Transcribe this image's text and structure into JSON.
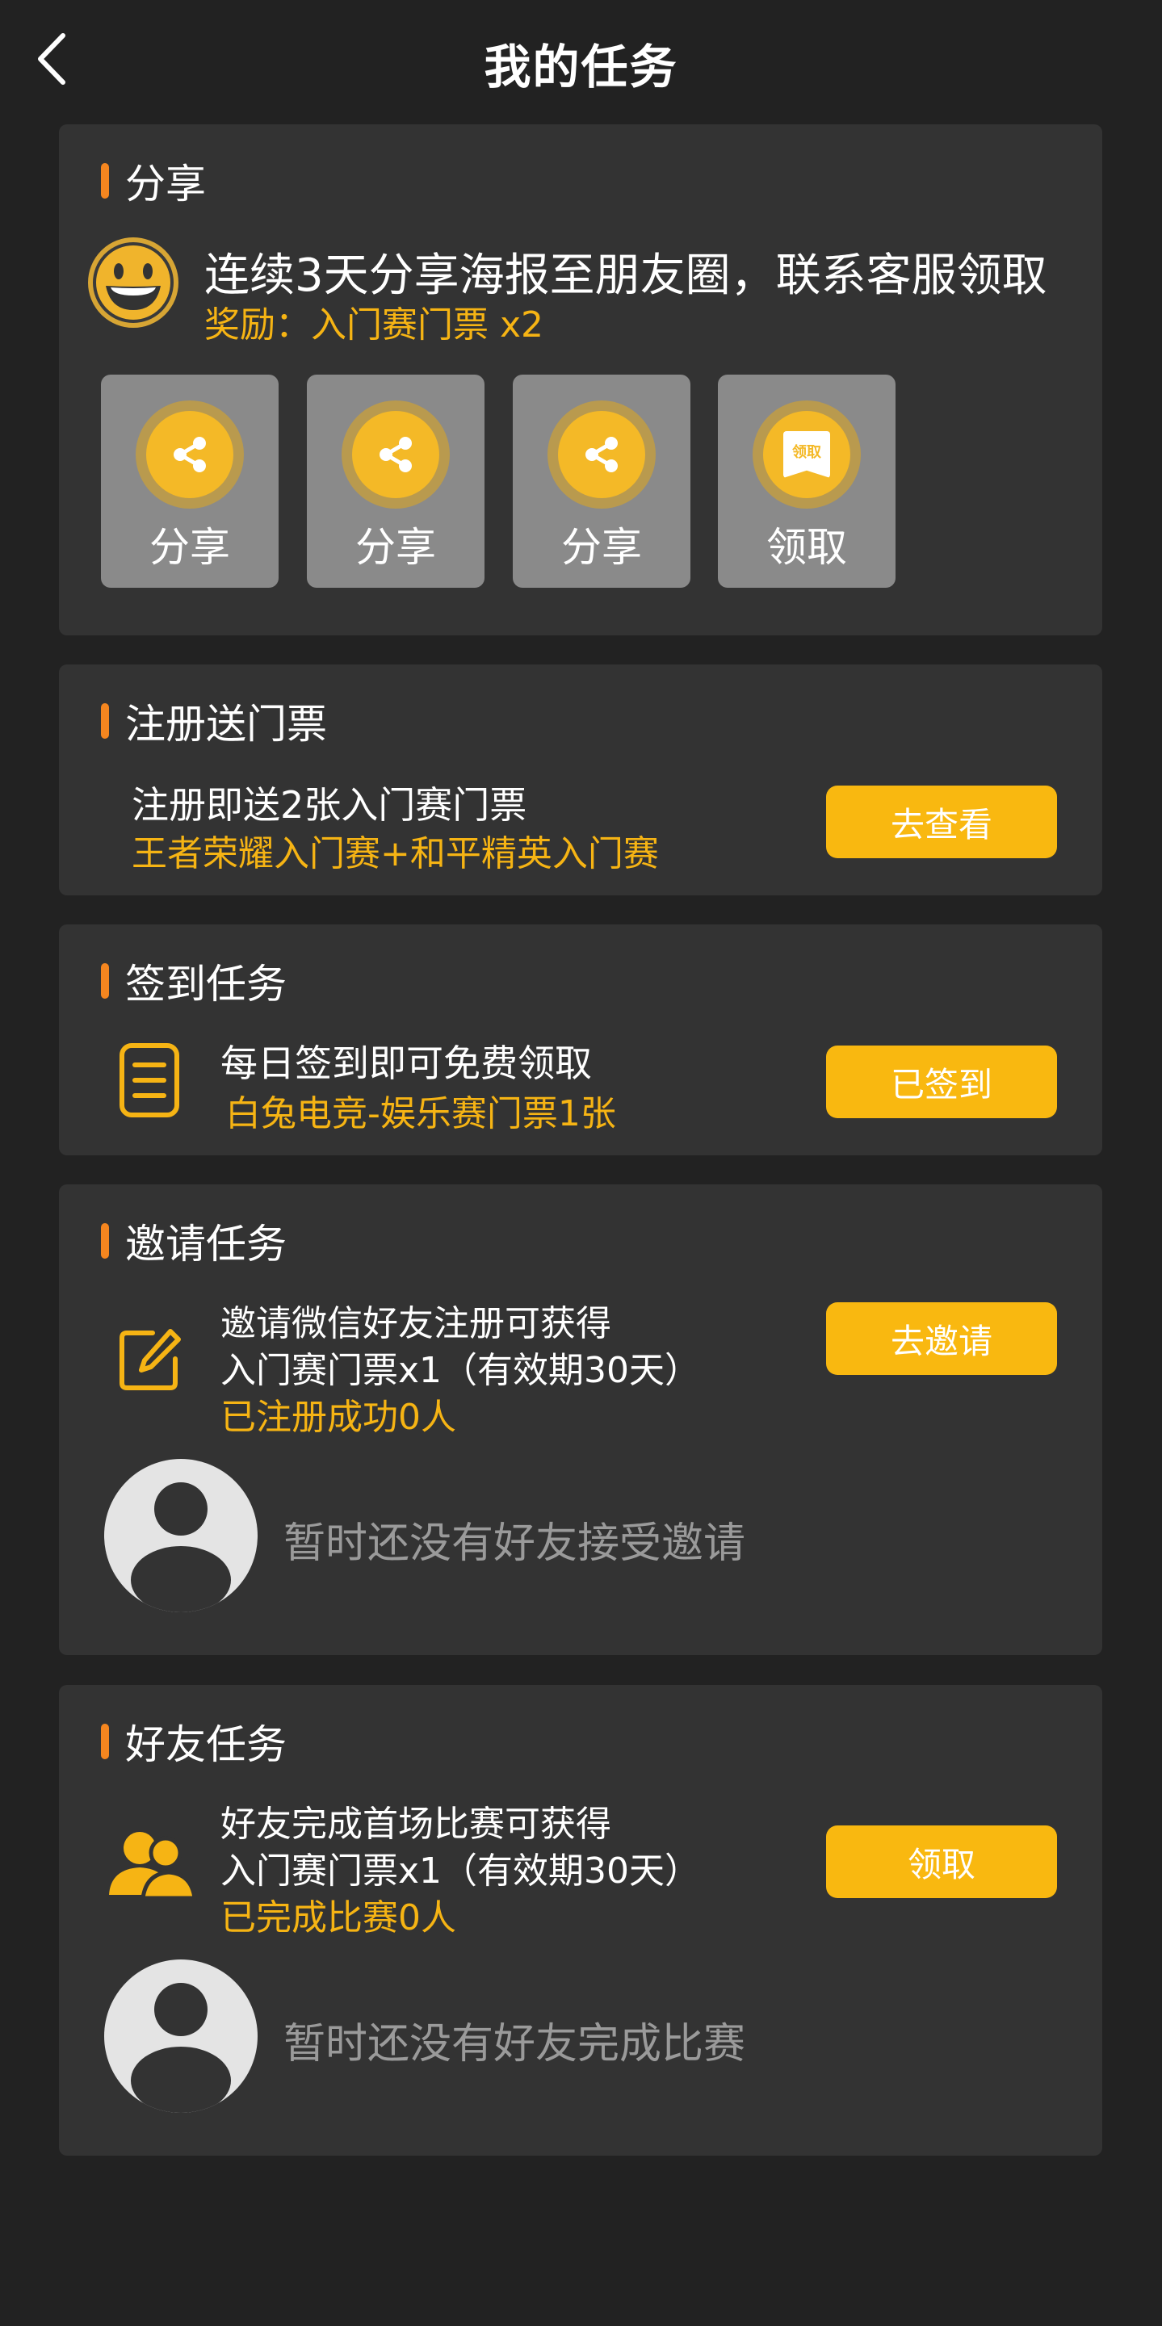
{
  "header": {
    "title": "我的任务"
  },
  "share_section": {
    "title": "分享",
    "desc": "连续3天分享海报至朋友圈，联系客服领取",
    "reward": "奖励：入门赛门票 x2",
    "tiles": [
      {
        "label": "分享",
        "icon": "share-icon"
      },
      {
        "label": "分享",
        "icon": "share-icon"
      },
      {
        "label": "分享",
        "icon": "share-icon"
      },
      {
        "label": "领取",
        "icon": "receive-badge-icon",
        "badge_text": "领取"
      }
    ]
  },
  "register_section": {
    "title": "注册送门票",
    "desc": "注册即送2张入门赛门票",
    "sub": "王者荣耀入门赛+和平精英入门赛",
    "button": "去查看"
  },
  "checkin_section": {
    "title": "签到任务",
    "desc": "每日签到即可免费领取",
    "sub": "白兔电竞-娱乐赛门票1张",
    "button": "已签到",
    "icon": "checklist-icon"
  },
  "invite_section": {
    "title": "邀请任务",
    "line1": "邀请微信好友注册可获得",
    "line2": "入门赛门票x1（有效期30天）",
    "status": "已注册成功0人",
    "button": "去邀请",
    "empty_text": "暂时还没有好友接受邀请",
    "icon": "edit-icon"
  },
  "friend_section": {
    "title": "好友任务",
    "line1": "好友完成首场比赛可获得",
    "line2": "入门赛门票x1（有效期30天）",
    "status": "已完成比赛0人",
    "button": "领取",
    "empty_text": "暂时还没有好友完成比赛",
    "icon": "friends-icon"
  },
  "colors": {
    "background": "#222222",
    "card": "#333333",
    "accent_orange": "#f5861f",
    "gold_text": "#f6b414",
    "button": "#f9b810",
    "tile": "#8a8a8a"
  }
}
